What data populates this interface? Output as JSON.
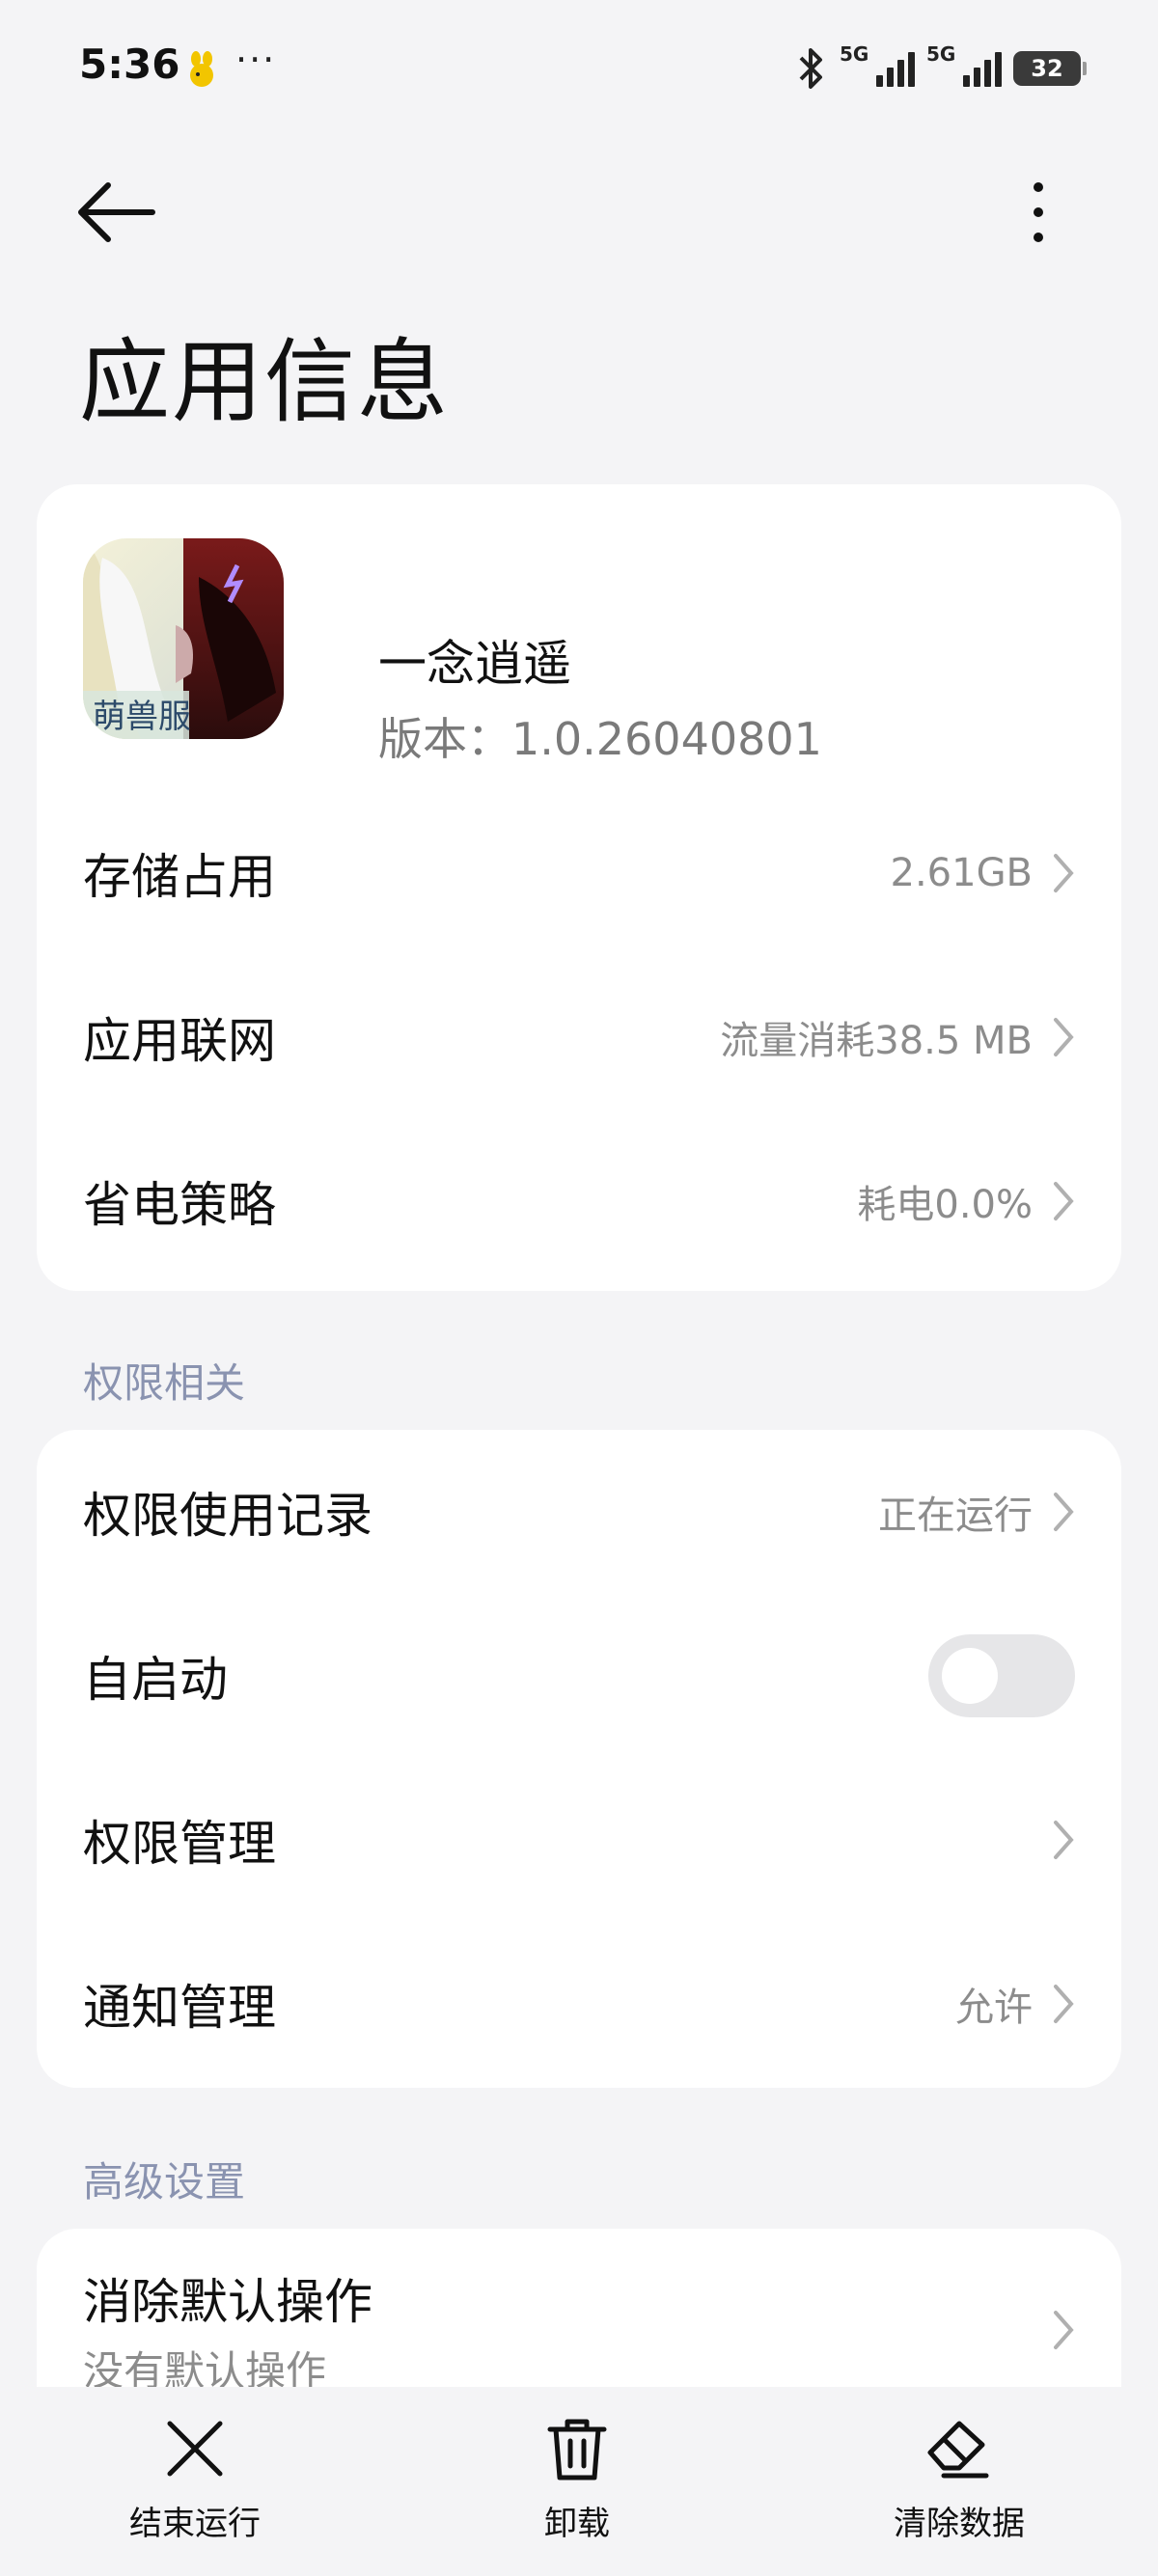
{
  "status_bar": {
    "time": "5:36",
    "more": "···",
    "network1": "5G",
    "network2": "5G",
    "battery": "32"
  },
  "header": {
    "title": "应用信息"
  },
  "app": {
    "name": "一念逍遥",
    "version": "版本：1.0.26040801",
    "icon_caption": "萌兽服"
  },
  "app_rows": [
    {
      "label": "存储占用",
      "value": "2.61GB"
    },
    {
      "label": "应用联网",
      "value": "流量消耗38.5 MB"
    },
    {
      "label": "省电策略",
      "value": "耗电0.0%"
    }
  ],
  "permissions": {
    "section_title": "权限相关",
    "rows": [
      {
        "label": "权限使用记录",
        "value": "正在运行"
      },
      {
        "label": "自启动",
        "toggle": false
      },
      {
        "label": "权限管理",
        "value": ""
      },
      {
        "label": "通知管理",
        "value": "允许"
      }
    ]
  },
  "advanced": {
    "section_title": "高级设置",
    "rows": [
      {
        "label": "消除默认操作",
        "sublabel": "没有默认操作"
      }
    ]
  },
  "toolbar": {
    "stop_label": "结束运行",
    "uninstall_label": "卸载",
    "clear_label": "清除数据"
  },
  "colors": {
    "background": "#f4f4f6",
    "card": "#ffffff",
    "section_title": "#8a93b0",
    "secondary_text": "#8c8c8c"
  }
}
